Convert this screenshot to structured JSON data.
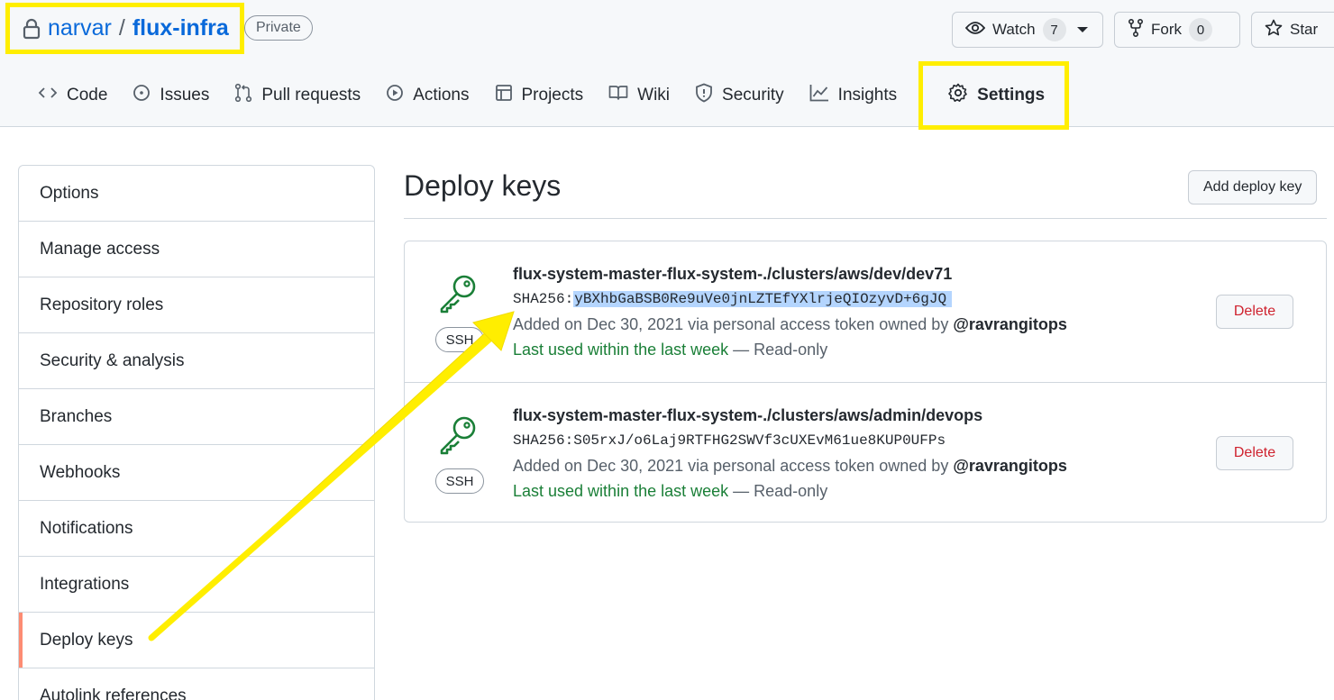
{
  "repo": {
    "owner": "narvar",
    "separator": "/",
    "name": "flux-infra",
    "visibility": "Private"
  },
  "actions": {
    "watch": {
      "label": "Watch",
      "count": "7"
    },
    "fork": {
      "label": "Fork",
      "count": "0"
    },
    "star": {
      "label": "Star"
    }
  },
  "tabs": [
    {
      "label": "Code",
      "icon": "code-icon"
    },
    {
      "label": "Issues",
      "icon": "issue-icon"
    },
    {
      "label": "Pull requests",
      "icon": "pull-request-icon"
    },
    {
      "label": "Actions",
      "icon": "play-icon"
    },
    {
      "label": "Projects",
      "icon": "table-icon"
    },
    {
      "label": "Wiki",
      "icon": "book-icon"
    },
    {
      "label": "Security",
      "icon": "shield-icon"
    },
    {
      "label": "Insights",
      "icon": "graph-icon"
    },
    {
      "label": "Settings",
      "icon": "gear-icon",
      "active": true
    }
  ],
  "sidebar": {
    "items": [
      {
        "label": "Options"
      },
      {
        "label": "Manage access"
      },
      {
        "label": "Repository roles"
      },
      {
        "label": "Security & analysis"
      },
      {
        "label": "Branches"
      },
      {
        "label": "Webhooks"
      },
      {
        "label": "Notifications"
      },
      {
        "label": "Integrations"
      },
      {
        "label": "Deploy keys",
        "selected": true
      },
      {
        "label": "Autolink references"
      }
    ]
  },
  "main": {
    "title": "Deploy keys",
    "add_button": "Add deploy key",
    "keys": [
      {
        "title": "flux-system-master-flux-system-./clusters/aws/dev/dev71",
        "fp_prefix": "SHA256:",
        "fp_value": "yBXhbGaBSB0Re9uVe0jnLZTEfYXlrjeQIOzyvD+6gJQ",
        "added_text": "Added on Dec 30, 2021 via personal access token owned by ",
        "owner": "@ravrangitops",
        "used_green": "Last used within the last week",
        "used_rest": " — Read-only",
        "badge": "SSH",
        "delete_label": "Delete"
      },
      {
        "title": "flux-system-master-flux-system-./clusters/aws/admin/devops",
        "fp_prefix": "SHA256:",
        "fp_value": "S05rxJ/o6Laj9RTFHG2SWVf3cUXEvM61ue8KUP0UFPs",
        "added_text": "Added on Dec 30, 2021 via personal access token owned by ",
        "owner": "@ravrangitops",
        "used_green": "Last used within the last week",
        "used_rest": " — Read-only",
        "badge": "SSH",
        "delete_label": "Delete"
      }
    ]
  },
  "colors": {
    "highlight": "#ffee00",
    "link": "#0969da",
    "success": "#1a7f37",
    "danger": "#cf222e",
    "selected_marker": "#fd8c73"
  }
}
